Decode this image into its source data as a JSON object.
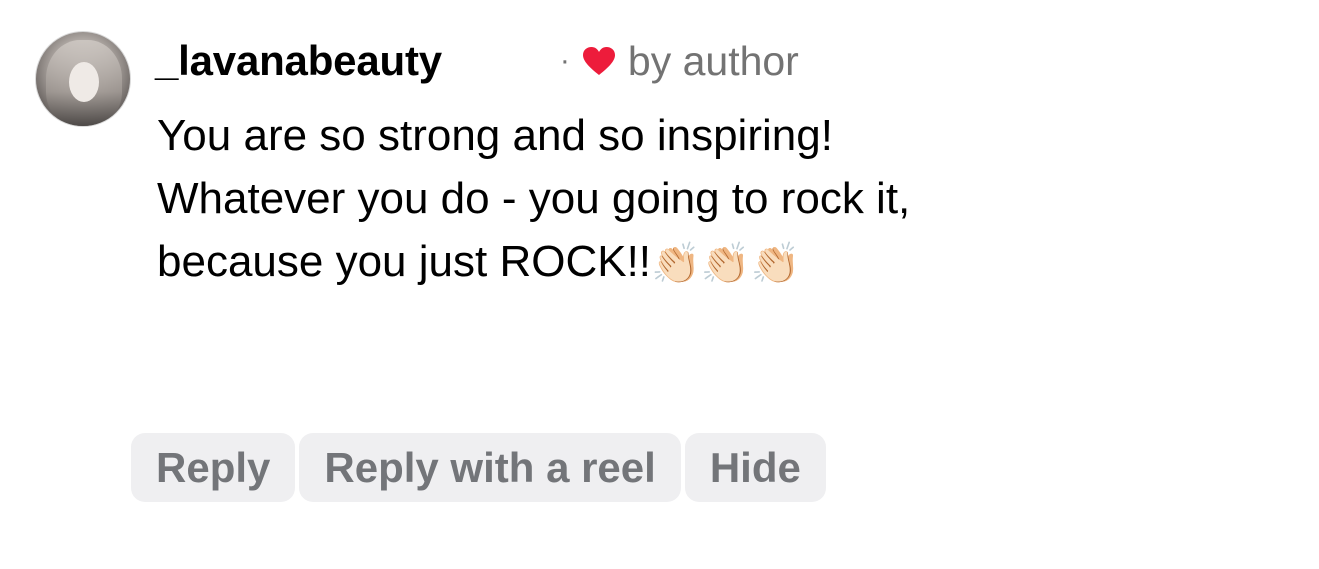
{
  "comment": {
    "username": "_lavanabeauty",
    "separator": "·",
    "liked_by_label": "by author",
    "text_line_1": "You are so strong and so inspiring!",
    "text_line_2": "Whatever you do - you going to rock it,",
    "text_line_3": "because you just ROCK!!",
    "emoji": "👏🏻👏🏻👏🏻"
  },
  "icons": {
    "avatar": "profile-photo",
    "liked": "heart-icon"
  },
  "colors": {
    "heart": "#ed1c3b",
    "secondary_text": "#737373",
    "button_bg": "#efeff1",
    "button_text": "#737579"
  },
  "actions": {
    "reply_label": "Reply",
    "reply_reel_label": "Reply with a reel",
    "hide_label": "Hide"
  }
}
